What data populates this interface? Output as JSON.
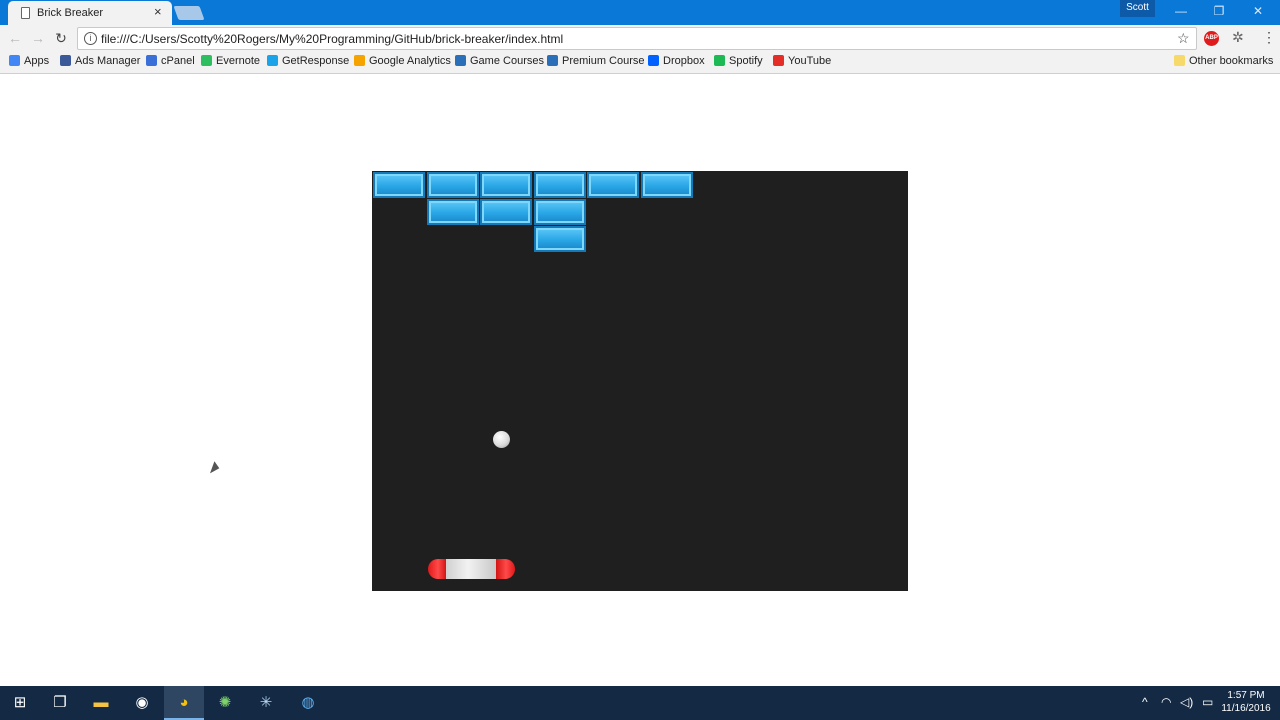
{
  "tab": {
    "title": "Brick Breaker",
    "close": "×"
  },
  "window": {
    "user": "Scott",
    "minimize": "—",
    "restore": "❐",
    "close": "✕"
  },
  "toolbar": {
    "back": "←",
    "forward": "→",
    "reload": "↻",
    "info": "i",
    "url": "file:///C:/Users/Scotty%20Rogers/My%20Programming/GitHub/brick-breaker/index.html",
    "star": "☆",
    "abp": "ABP",
    "extension": "✲",
    "menu": "⋮"
  },
  "bookmarks": [
    {
      "label": "Apps",
      "color": "#4285f4"
    },
    {
      "label": "Ads Manager",
      "color": "#3b5998"
    },
    {
      "label": "cPanel",
      "color": "#3a6fd8"
    },
    {
      "label": "Evernote",
      "color": "#2dbe60"
    },
    {
      "label": "GetResponse",
      "color": "#1aa3e8"
    },
    {
      "label": "Google Analytics",
      "color": "#f4a300"
    },
    {
      "label": "Game Courses",
      "color": "#2a6fb8"
    },
    {
      "label": "Premium Course",
      "color": "#2a6fb8"
    },
    {
      "label": "Dropbox",
      "color": "#0061ff"
    },
    {
      "label": "Spotify",
      "color": "#1db954"
    },
    {
      "label": "YouTube",
      "color": "#e52d27"
    }
  ],
  "other_bookmarks": "Other bookmarks",
  "game": {
    "bricks": [
      {
        "col": 0,
        "row": 0
      },
      {
        "col": 1,
        "row": 0
      },
      {
        "col": 2,
        "row": 0
      },
      {
        "col": 3,
        "row": 0
      },
      {
        "col": 4,
        "row": 0
      },
      {
        "col": 5,
        "row": 0
      },
      {
        "col": 1,
        "row": 1
      },
      {
        "col": 2,
        "row": 1
      },
      {
        "col": 3,
        "row": 1
      },
      {
        "col": 3,
        "row": 2
      }
    ]
  },
  "taskbar": {
    "start": "⊞",
    "taskview": "❐",
    "explorer": "📁",
    "clock_time": "1:57 PM",
    "clock_date": "11/16/2016",
    "tray_up": "^",
    "tray_net": "◠",
    "tray_vol": "◁)",
    "tray_msg": "▭"
  }
}
